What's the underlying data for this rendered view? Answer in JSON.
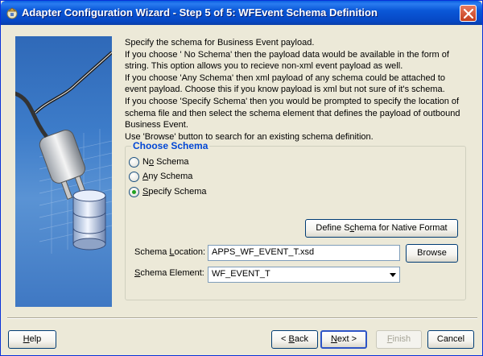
{
  "window": {
    "title": "Adapter Configuration Wizard - Step 5 of 5: WFEvent Schema Definition"
  },
  "instructions": [
    "Specify the schema for  Business Event payload.",
    "If you choose ' No Schema' then the payload data would be available in the form of",
    "string. This option allows you to recieve non-xml event payload as well.",
    "If you choose 'Any Schema' then xml payload of any schema could be attached to",
    "event payload. Choose this if you know payload is xml but not sure of it's schema.",
    "If you choose 'Specify Schema' then you would be prompted to specify the location of",
    "schema file and then select the schema element that defines the payload of outbound",
    "Business Event.",
    "Use 'Browse' button to search for an existing schema definition."
  ],
  "choose_schema": {
    "legend": "Choose Schema",
    "options": [
      {
        "label": "No Schema",
        "mnemonic": "o",
        "checked": false
      },
      {
        "label": "Any Schema",
        "mnemonic": "A",
        "checked": false
      },
      {
        "label": "Specify Schema",
        "mnemonic": "S",
        "checked": true
      }
    ],
    "define_native_button": "Define Schema for Native Format",
    "location_label": "Schema Location:",
    "location_value": "APPS_WF_EVENT_T.xsd",
    "browse_button": "Browse",
    "element_label": "Schema Element:",
    "element_value": "WF_EVENT_T"
  },
  "footer": {
    "help": "Help",
    "back": "< Back",
    "next": "Next >",
    "finish": "Finish",
    "cancel": "Cancel"
  },
  "colors": {
    "title_bar": "#0a58d8",
    "legend_text": "#0046d5",
    "window_bg": "#ece9d8"
  },
  "icons": [
    "wizard-app-icon",
    "close-icon",
    "plug-database-illustration",
    "dropdown-arrow-icon"
  ]
}
